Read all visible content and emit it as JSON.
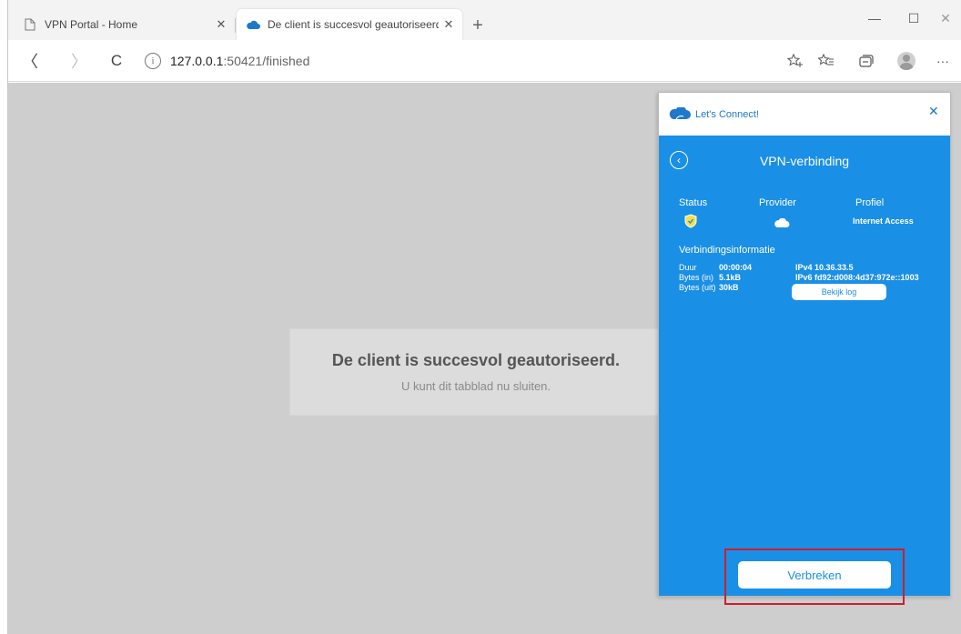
{
  "browser": {
    "tabs": [
      {
        "title": "VPN Portal - Home",
        "icon": "page-icon",
        "active": false
      },
      {
        "title": "De client is succesvol geautoriseerd",
        "icon": "cloud-icon",
        "active": true
      }
    ],
    "tab_close_glyph": "✕",
    "new_tab_glyph": "+",
    "window_controls": {
      "minimize": "—",
      "maximize": "☐",
      "close": "✕"
    },
    "nav": {
      "back": "〈",
      "forward": "〉",
      "reload": "C"
    },
    "address": {
      "info_glyph": "i",
      "host": "127.0.0.1",
      "path": ":50421/finished"
    },
    "toolbar_icons": [
      "add-favorite-icon",
      "favorites-icon",
      "collections-icon",
      "profile-icon",
      "more-icon"
    ],
    "more_glyph": "···"
  },
  "page": {
    "title": "De client is succesvol geautoriseerd.",
    "subtitle": "U kunt dit tabblad nu sluiten."
  },
  "vpn_app": {
    "app_title": "Let's Connect!",
    "close_glyph": "✕",
    "back_glyph": "‹",
    "heading": "VPN-verbinding",
    "columns": {
      "status_label": "Status",
      "provider_label": "Provider",
      "profile_label": "Profiel",
      "profile_value": "Internet Access"
    },
    "info_heading": "Verbindingsinformatie",
    "stats": [
      {
        "label": "Duur",
        "value": "00:00:04"
      },
      {
        "label": "Bytes (in)",
        "value": "5.1kB"
      },
      {
        "label": "Bytes (uit)",
        "value": "30kB"
      }
    ],
    "ipv4": "IPv4 10.36.33.5",
    "ipv6": "IPv6 fd92:d008:4d37:972e::1003",
    "log_button": "Bekijk log",
    "disconnect_button": "Verbreken",
    "colors": {
      "accent": "#1a8fe6",
      "highlight": "#cc1f2d"
    }
  }
}
